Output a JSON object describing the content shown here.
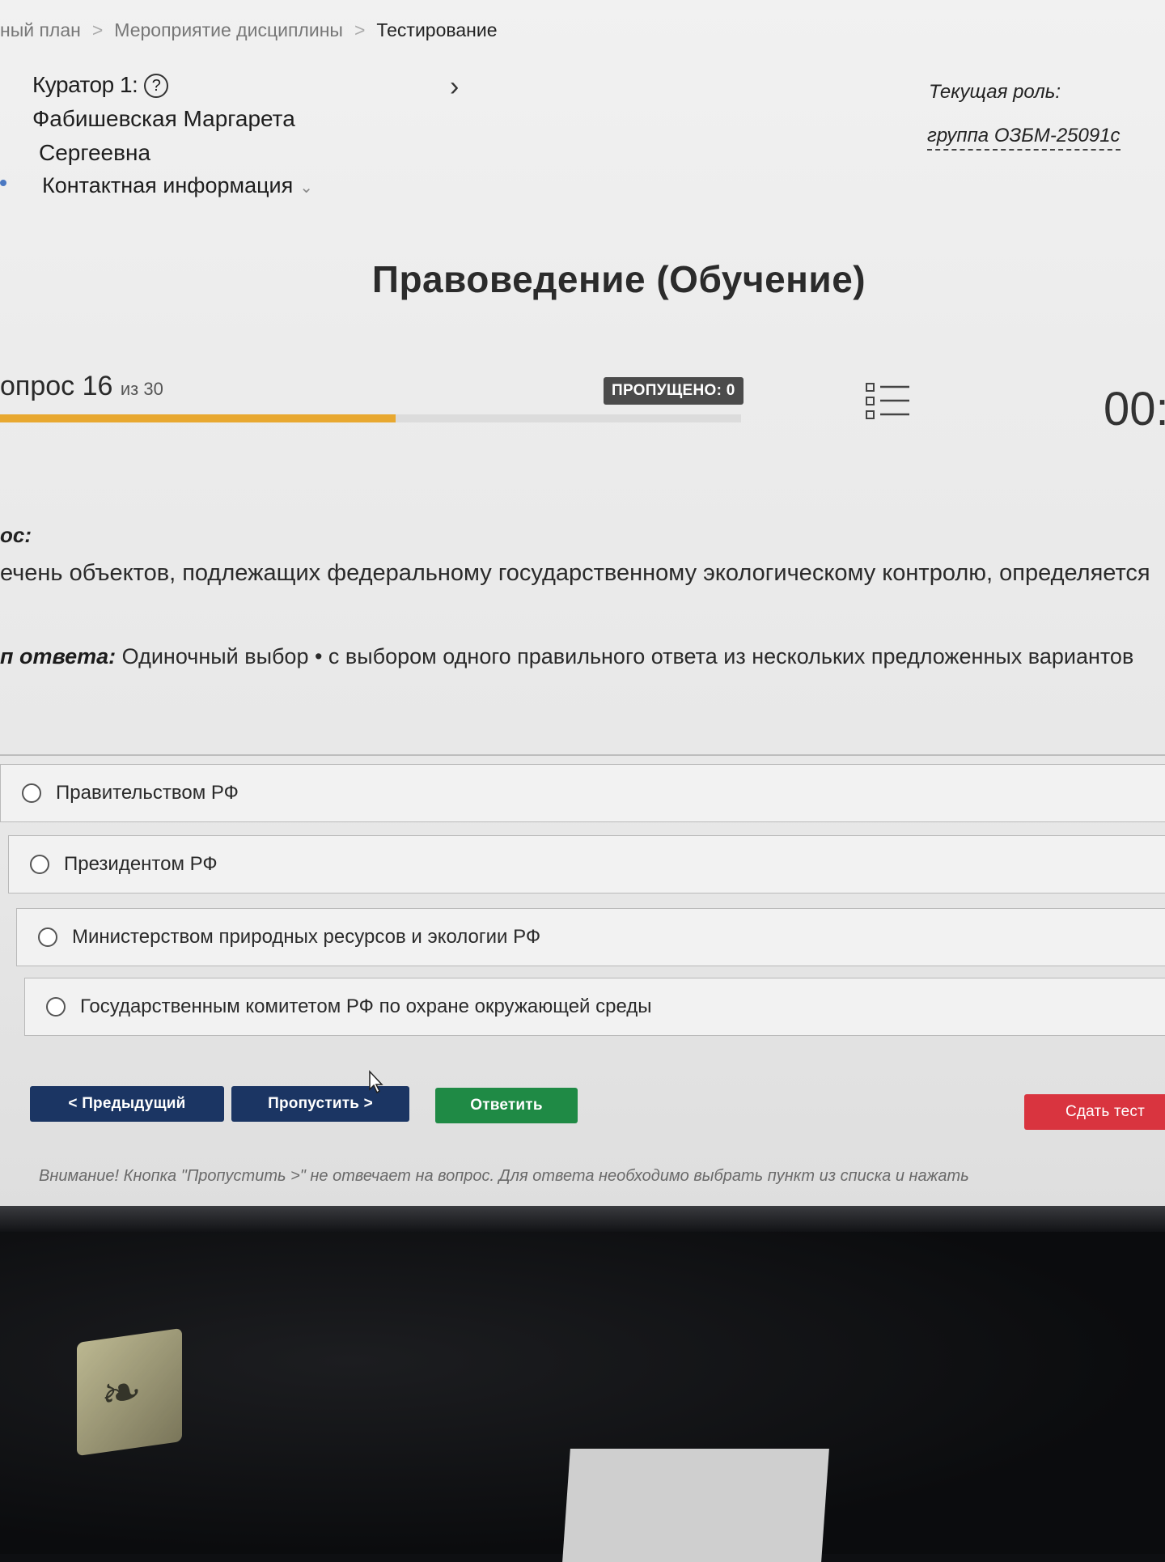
{
  "breadcrumb": {
    "items": [
      "ный план",
      "Мероприятие дисциплины",
      "Тестирование"
    ]
  },
  "curator": {
    "label": "Куратор 1:",
    "name_line1": "Фабишевская Маргарета",
    "name_line2": "Сергеевна",
    "contact": "Контактная информация"
  },
  "role": {
    "label": "Текущая роль:",
    "group": "группа ОЗБМ-25091с"
  },
  "title": "Правоведение (Обучение)",
  "progress": {
    "question_prefix": "опрос 16",
    "question_total": "из 30",
    "current": 16,
    "total": 30,
    "skipped_label": "ПРОПУЩЕНО: 0",
    "timer": "00:",
    "fill_color": "#e8a830"
  },
  "question": {
    "heading": "ос:",
    "text": "ечень объектов, подлежащих федеральному государственному экологическому контролю, определяется",
    "answer_type_label": "п ответа:",
    "answer_type_text": " Одиночный выбор • с выбором одного правильного ответа из нескольких предложенных вариантов"
  },
  "options": [
    "Правительством РФ",
    "Президентом РФ",
    "Министерством природных ресурсов и экологии РФ",
    "Государственным комитетом РФ по охране окружающей среды"
  ],
  "buttons": {
    "prev": "< Предыдущий",
    "skip": "Пропустить >",
    "answer": "Ответить",
    "submit": "Сдать тест"
  },
  "notice": "Внимание! Кнопка \"Пропустить >\" не отвечает на вопрос. Для ответа необходимо выбрать пункт из списка и нажать",
  "colors": {
    "nav_button": "#1b3563",
    "answer_button": "#1f8a45",
    "submit_button": "#d9343f",
    "skipped_badge": "#4b4b4b"
  },
  "icons": [
    "help-icon",
    "chevron-right-icon",
    "chevron-down-icon",
    "question-list-icon",
    "mouse-cursor-icon"
  ]
}
